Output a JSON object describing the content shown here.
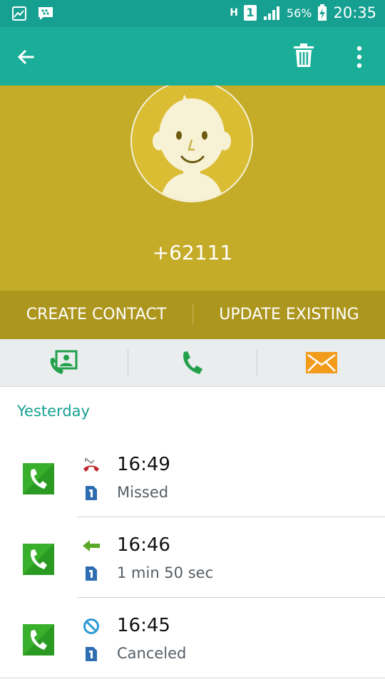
{
  "status_bar": {
    "network": "H",
    "sim": "1",
    "battery": "56%",
    "time": "20:35"
  },
  "header": {
    "phone_number": "+62111",
    "create_label": "CREATE CONTACT",
    "update_label": "UPDATE EXISTING"
  },
  "colors": {
    "status_bar": "#16a091",
    "app_bar": "#1aae98",
    "hero": "#c4ab28",
    "actions": "#ad961e",
    "accent_text": "#16a091",
    "call_green": "#38b02c",
    "missed_red": "#c0272d",
    "message_orange": "#f39b1a"
  },
  "log": {
    "section": "Yesterday",
    "entries": [
      {
        "time": "16:49",
        "detail": "Missed",
        "type_icon": "missed-call-icon"
      },
      {
        "time": "16:46",
        "detail": "1 min 50 sec",
        "type_icon": "incoming-call-icon"
      },
      {
        "time": "16:45",
        "detail": "Canceled",
        "type_icon": "canceled-call-icon"
      }
    ]
  }
}
